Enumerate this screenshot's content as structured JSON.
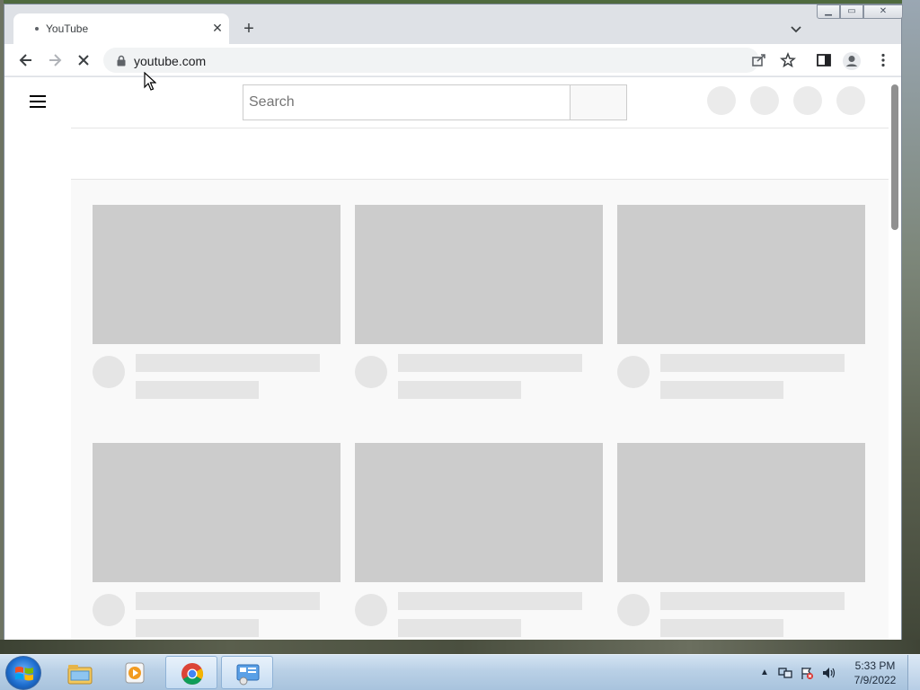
{
  "browser": {
    "tab_title": "YouTube",
    "new_tab_label": "+",
    "tab_close_label": "✕",
    "url": "youtube.com",
    "window_controls": {
      "minimize": "▁",
      "maximize": "▭",
      "close": "✕"
    }
  },
  "page": {
    "search_placeholder": "Search",
    "cards": [
      {
        "row": 1,
        "col": 1
      },
      {
        "row": 1,
        "col": 2
      },
      {
        "row": 1,
        "col": 3
      },
      {
        "row": 2,
        "col": 1
      },
      {
        "row": 2,
        "col": 2
      },
      {
        "row": 2,
        "col": 3
      }
    ]
  },
  "taskbar": {
    "clock_time": "5:33 PM",
    "clock_date": "7/9/2022",
    "tray_arrow": "▲"
  },
  "colors": {
    "skeleton_thumb": "#cccccc",
    "skeleton_line": "#e5e5e5",
    "omnibox_bg": "#f1f3f4",
    "tabstrip_bg": "#dee1e6"
  }
}
